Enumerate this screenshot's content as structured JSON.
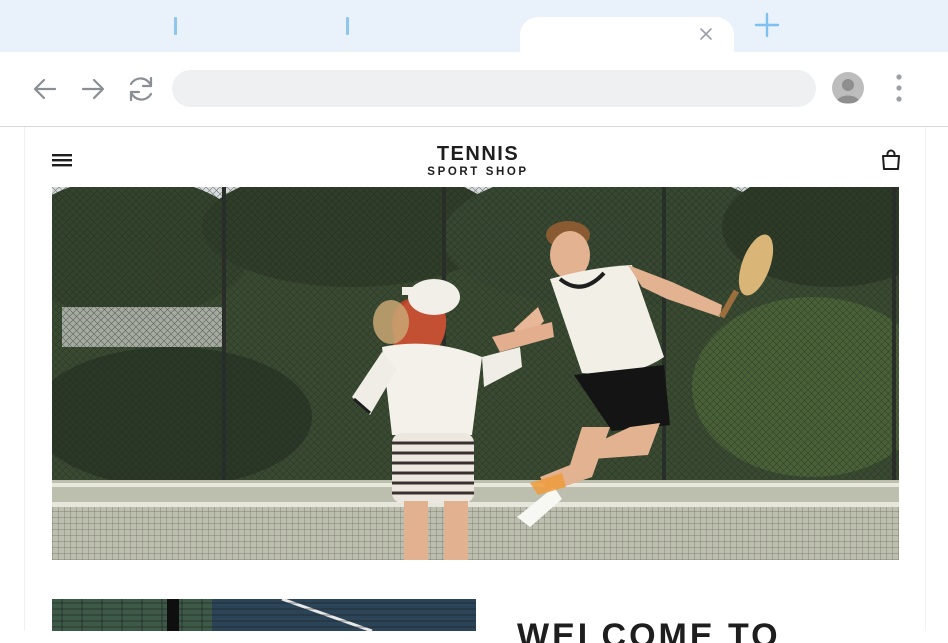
{
  "browser": {
    "url": "",
    "icons": {
      "back": "arrow-left-icon",
      "forward": "arrow-right-icon",
      "reload": "reload-icon",
      "close_tab": "close-icon",
      "new_tab": "plus-icon",
      "profile": "avatar-icon",
      "menu": "kebab-menu-icon"
    },
    "colors": {
      "tabstrip": "#e9f1fb",
      "accent": "#8fc6f0",
      "urlbar": "#eef0f2"
    }
  },
  "site": {
    "brand_title": "TENNIS",
    "brand_subtitle": "SPORT SHOP",
    "icons": {
      "menu": "hamburger-icon",
      "cart": "shopping-bag-icon"
    },
    "hero_image": "two tennis players high-fiving on a court behind a net",
    "welcome_heading": "WELCOME TO",
    "colors": {
      "text": "#1e1e1e"
    }
  }
}
